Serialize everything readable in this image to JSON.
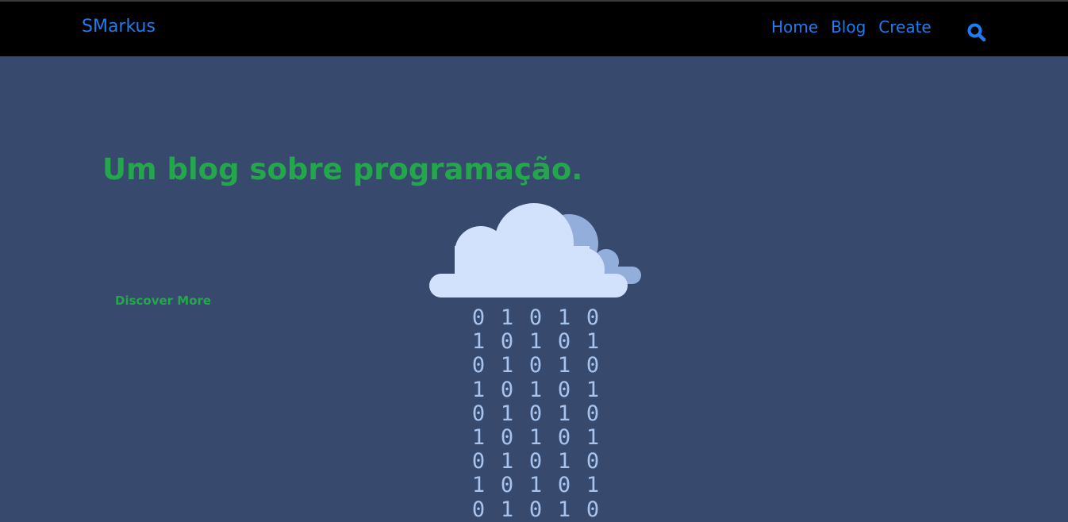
{
  "navbar": {
    "brand": "SMarkus",
    "links": [
      "Home",
      "Blog",
      "Create"
    ],
    "search_icon": "search-icon"
  },
  "hero": {
    "title": "Um blog sobre programação.",
    "cta": "Discover More"
  },
  "illustration": {
    "icon": "cloud-icon",
    "binary_rows": [
      [
        "0",
        "1",
        "0",
        "1",
        "0"
      ],
      [
        "1",
        "0",
        "1",
        "0",
        "1"
      ],
      [
        "0",
        "1",
        "0",
        "1",
        "0"
      ],
      [
        "1",
        "0",
        "1",
        "0",
        "1"
      ],
      [
        "0",
        "1",
        "0",
        "1",
        "0"
      ],
      [
        "1",
        "0",
        "1",
        "0",
        "1"
      ],
      [
        "0",
        "1",
        "0",
        "1",
        "0"
      ],
      [
        "1",
        "0",
        "1",
        "0",
        "1"
      ],
      [
        "0",
        "1",
        "0",
        "1",
        "0"
      ]
    ]
  },
  "colors": {
    "background": "#374a6e",
    "navbar": "#000000",
    "link": "#1f7cf0",
    "accent_green": "#22a84a",
    "cloud_front": "#d2e1fc",
    "cloud_back": "#94aedb",
    "binary": "#a8c4ee"
  }
}
